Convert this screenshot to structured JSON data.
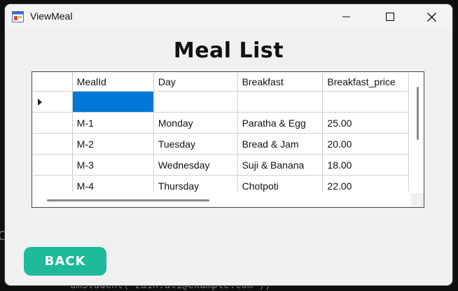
{
  "window": {
    "title": "ViewMeal"
  },
  "page": {
    "heading": "Meal List"
  },
  "grid": {
    "columns": [
      "MealId",
      "Day",
      "Breakfast",
      "Breakfast_price"
    ],
    "new_row": [
      "",
      "",
      "",
      ""
    ],
    "rows": [
      [
        "M-1",
        "Monday",
        "Paratha & Egg",
        "25.00"
      ],
      [
        "M-2",
        "Tuesday",
        "Bread & Jam",
        "20.00"
      ],
      [
        "M-3",
        "Wednesday",
        "Suji & Banana",
        "18.00"
      ],
      [
        "M-4",
        "Thursday",
        "Chotpoti",
        "22.00"
      ]
    ]
  },
  "actions": {
    "back_label": "BACK"
  },
  "colors": {
    "accent": "#1fba99",
    "selection": "#0078d7"
  },
  "background": {
    "left_glyph": "C",
    "bottom_code": "umStudent( zain.ali@example.com );"
  }
}
